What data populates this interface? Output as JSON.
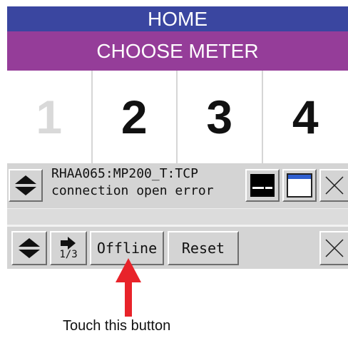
{
  "header": {
    "home_label": "HOME",
    "choose_label": "CHOOSE METER"
  },
  "meters": [
    {
      "label": "1",
      "active": false
    },
    {
      "label": "2",
      "active": true
    },
    {
      "label": "3",
      "active": true
    },
    {
      "label": "4",
      "active": true
    }
  ],
  "status_panel": {
    "line1": "RHAA065:MP200_T:TCP",
    "line2": "connection open error"
  },
  "control_panel": {
    "page_indicator": "1/3",
    "offline_label": "Offline",
    "reset_label": "Reset"
  },
  "annotation": {
    "text": "Touch this button",
    "arrow_color": "#e8232a"
  },
  "colors": {
    "home_bar": "#3a46a0",
    "choose_bar": "#953d99",
    "panel_gray": "#d4d4d4"
  }
}
